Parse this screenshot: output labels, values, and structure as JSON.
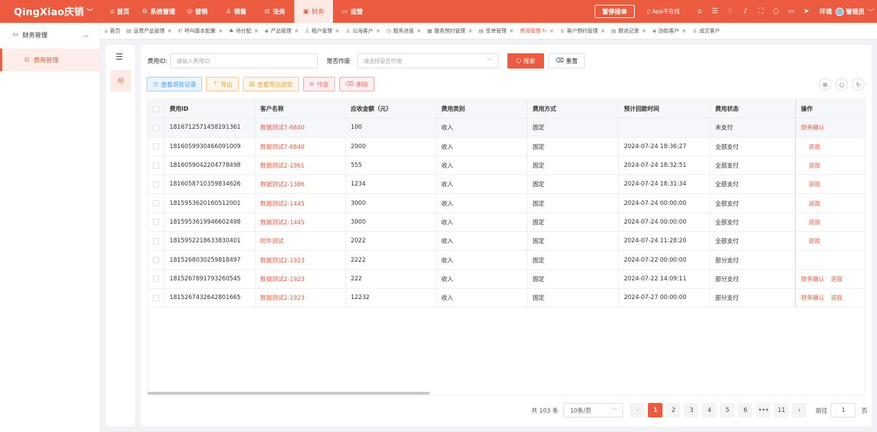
{
  "brand": {
    "name": "QingXiao庆销"
  },
  "topnav": {
    "items": [
      {
        "icon": "⌂",
        "label": "首页"
      },
      {
        "icon": "⚙",
        "label": "系统管理"
      },
      {
        "icon": "◎",
        "label": "营销"
      },
      {
        "icon": "♙",
        "label": "销售"
      },
      {
        "icon": "⚖",
        "label": "法务"
      },
      {
        "icon": "▣",
        "label": "财务"
      },
      {
        "icon": "▭",
        "label": "运营"
      }
    ],
    "active_index": 5,
    "pause_label": "暂停接单",
    "app_status": "App不在线",
    "env_label": "环境",
    "user_label": "管理员"
  },
  "tabs": [
    {
      "icon": "⌂",
      "label": "首页",
      "closable": false
    },
    {
      "icon": "▤",
      "label": "运营产品管理",
      "closable": true
    },
    {
      "icon": "✆",
      "label": "呼叫基本配置",
      "closable": true
    },
    {
      "icon": "♣",
      "label": "待分配",
      "closable": true
    },
    {
      "icon": "◈",
      "label": "产品管理",
      "closable": true
    },
    {
      "icon": "♙",
      "label": "租户管理",
      "closable": true
    },
    {
      "icon": "♙",
      "label": "公海客户",
      "closable": true
    },
    {
      "icon": "◷",
      "label": "服务进度",
      "closable": true
    },
    {
      "icon": "▦",
      "label": "服务预约管理",
      "closable": true
    },
    {
      "icon": "▤",
      "label": "签单管理",
      "closable": true
    },
    {
      "icon": "",
      "label": "费用管理 ↻",
      "closable": true,
      "active": true
    },
    {
      "icon": "♙",
      "label": "客户预约管理",
      "closable": true
    },
    {
      "icon": "▤",
      "label": "跟进记录",
      "closable": true
    },
    {
      "icon": "◈",
      "label": "协助客户",
      "closable": true
    },
    {
      "icon": "♙",
      "label": "成交客户",
      "closable": false
    }
  ],
  "sidebar": {
    "group_label": "财务管理",
    "item_label": "费用管理"
  },
  "leftpanel": {
    "tag": "所"
  },
  "filters": {
    "fee_id_label": "费用ID:",
    "fee_id_placeholder": "请输入费用ID",
    "void_label": "是否作废",
    "void_placeholder": "请选择是否作废",
    "search_label": "搜索",
    "reset_label": "重置"
  },
  "actions": {
    "refund_records": "查看退款记录",
    "export": "导出",
    "export_progress": "查看导出进度",
    "void": "作废",
    "delete": "删除"
  },
  "table": {
    "headers": [
      "费用ID",
      "客户名称",
      "应收金额（元）",
      "费用类别",
      "费用方式",
      "预计回款时间",
      "费用状态",
      "操作"
    ],
    "rows": [
      {
        "id": "1816712571458191361",
        "customer": "数据测试7-6840",
        "amount": "100",
        "category": "收入",
        "method": "固定",
        "time": "",
        "status": "未支付",
        "ops": [
          "财务确认"
        ]
      },
      {
        "id": "1816059930466091009",
        "customer": "数据测试7-6840",
        "amount": "2000",
        "category": "收入",
        "method": "固定",
        "time": "2024-07-24 18:36:27",
        "status": "全部支付",
        "ops": [
          "退款"
        ]
      },
      {
        "id": "1816059042204778498",
        "customer": "数据测试2-1961",
        "amount": "555",
        "category": "收入",
        "method": "固定",
        "time": "2024-07-24 18:32:51",
        "status": "全部支付",
        "ops": [
          "退款"
        ]
      },
      {
        "id": "1816058710359834626",
        "customer": "数据测试2-1386",
        "amount": "1234",
        "category": "收入",
        "method": "固定",
        "time": "2024-07-24 18:31:34",
        "status": "全部支付",
        "ops": [
          "退款"
        ]
      },
      {
        "id": "1815953620160512001",
        "customer": "数据测试2-1445",
        "amount": "3000",
        "category": "收入",
        "method": "固定",
        "time": "2024-07-24 00:00:00",
        "status": "全部支付",
        "ops": [
          "退款"
        ]
      },
      {
        "id": "1815953619946602498",
        "customer": "数据测试2-1445",
        "amount": "3000",
        "category": "收入",
        "method": "固定",
        "time": "2024-07-24 00:00:00",
        "status": "全部支付",
        "ops": [
          "退款"
        ]
      },
      {
        "id": "1815952218633830401",
        "customer": "附件测试",
        "amount": "2022",
        "category": "收入",
        "method": "固定",
        "time": "2024-07-24 11:28:20",
        "status": "全部支付",
        "ops": [
          "退款"
        ]
      },
      {
        "id": "1815268030259818497",
        "customer": "数据测试2-1923",
        "amount": "2222",
        "category": "收入",
        "method": "固定",
        "time": "2024-07-22 00:00:00",
        "status": "部分支付",
        "ops": []
      },
      {
        "id": "1815267891793260545",
        "customer": "数据测试2-1923",
        "amount": "222",
        "category": "收入",
        "method": "固定",
        "time": "2024-07-22 14:09:11",
        "status": "部分支付",
        "ops": [
          "财务确认",
          "退款"
        ]
      },
      {
        "id": "1815267432642801665",
        "customer": "数据测试2-1923",
        "amount": "12232",
        "category": "收入",
        "method": "固定",
        "time": "2024-07-27 00:00:00",
        "status": "部分支付",
        "ops": [
          "财务确认",
          "退款"
        ]
      }
    ]
  },
  "pager": {
    "total": "共 103 条",
    "page_size": "10条/页",
    "pages": [
      "1",
      "2",
      "3",
      "4",
      "5",
      "6",
      "•••",
      "11"
    ],
    "current": "1",
    "goto_label": "前往",
    "goto_value": "1",
    "page_suffix": "页"
  },
  "colors": {
    "primary": "#ec5b3f",
    "blue": "#409eff",
    "orange": "#e6a23c",
    "red": "#f56c6c"
  }
}
